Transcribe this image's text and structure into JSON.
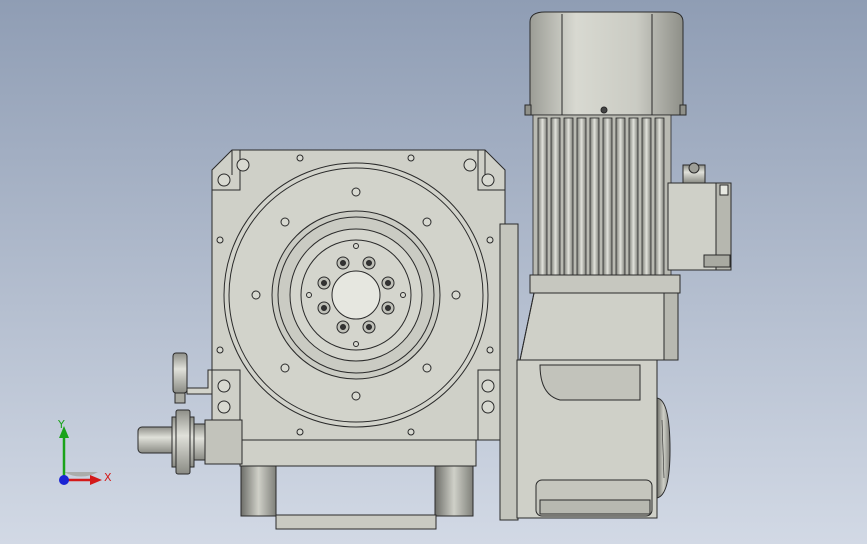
{
  "viewport": {
    "background_top": "#8f9db4",
    "background_bottom": "#d2d9e5",
    "part_fill": "#cfd0c8",
    "part_shadow": "#a9aaa2",
    "edge_color": "#2a2a2a"
  },
  "triad": {
    "x_label": "X",
    "y_label": "Y",
    "x_color": "#d41a1a",
    "y_color": "#1aa31a",
    "z_color": "#1a24d4"
  }
}
